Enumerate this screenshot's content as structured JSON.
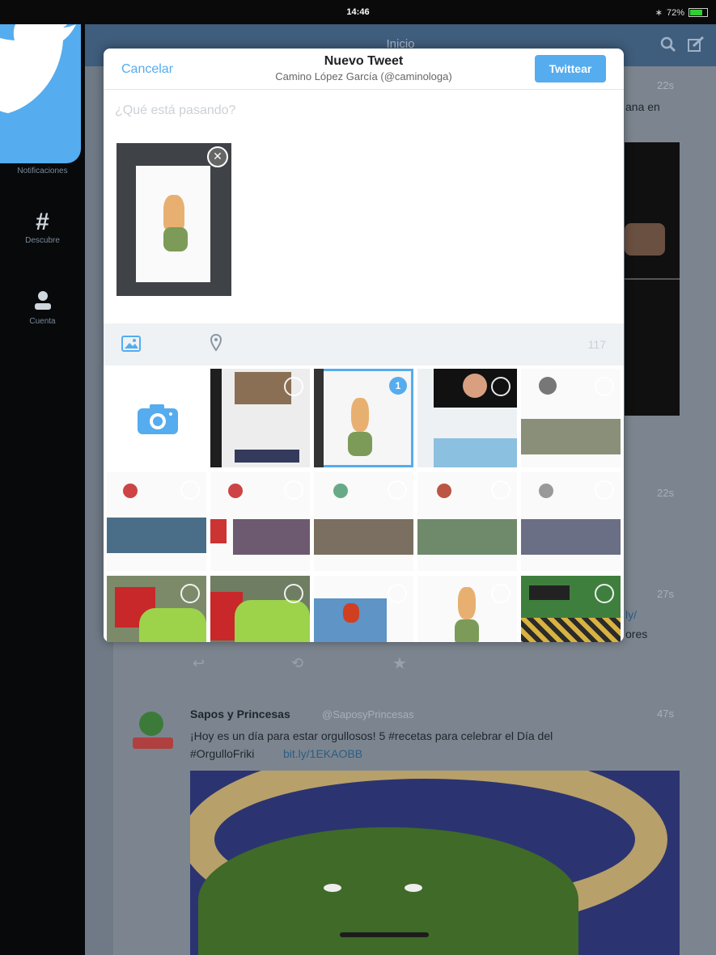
{
  "status": {
    "time": "14:46",
    "battery": "72%"
  },
  "nav": {
    "title": "Inicio"
  },
  "sidebar": {
    "items": [
      {
        "label": "Notificaciones",
        "icon": "bell-icon"
      },
      {
        "label": "Descubre",
        "icon": "hashtag-icon"
      },
      {
        "label": "Cuenta",
        "icon": "person-icon"
      }
    ]
  },
  "timeline": {
    "tweets": [
      {
        "time": "22s",
        "snippet": "ana en"
      },
      {
        "time": "22s"
      },
      {
        "time": "27s",
        "snippet_link": "ly/",
        "snippet2": "ores"
      },
      {
        "name": "Sapos y Princesas",
        "handle": "@SaposyPrincesas",
        "time": "47s",
        "text": "¡Hoy es un día para estar orgullosos! 5 #recetas para celebrar el Día del",
        "text2": "#OrgulloFriki",
        "link": "bit.ly/1EKAOBB"
      }
    ]
  },
  "compose": {
    "cancel_label": "Cancelar",
    "title": "Nuevo Tweet",
    "account": "Camino López García (@caminologa)",
    "tweet_label": "Twittear",
    "placeholder": "¿Qué está pasando?",
    "char_count": "117",
    "selected_count": "1"
  },
  "colors": {
    "accent": "#55acee",
    "nav": "#3f5d7c",
    "sidebar": "#07090b"
  }
}
